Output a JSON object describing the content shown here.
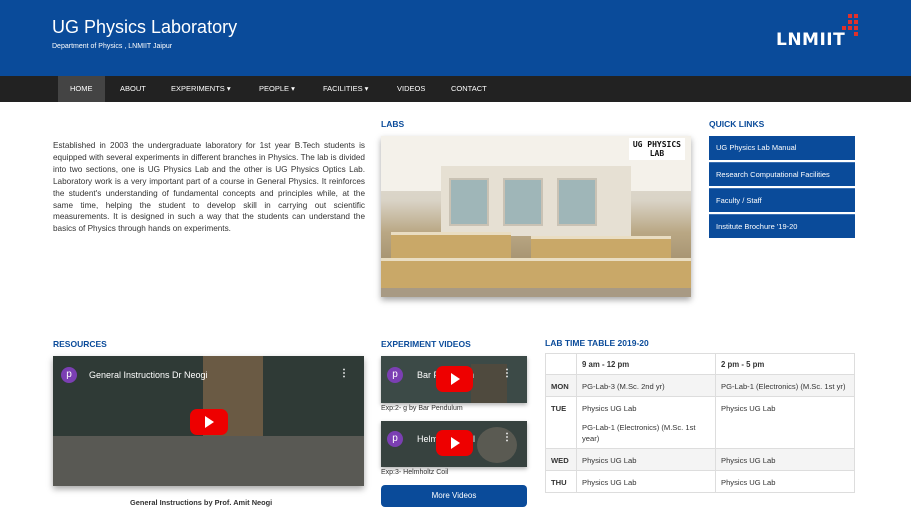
{
  "header": {
    "title": "UG Physics Laboratory",
    "subtitle": "Department of Physics , LNMIIT Jaipur",
    "logo_text": "LNMIIT"
  },
  "nav": {
    "items": [
      {
        "label": "HOME"
      },
      {
        "label": "ABOUT"
      },
      {
        "label": "EXPERIMENTS ▾"
      },
      {
        "label": "PEOPLE ▾"
      },
      {
        "label": "FACILITIES ▾"
      },
      {
        "label": "VIDEOS"
      },
      {
        "label": "CONTACT"
      }
    ]
  },
  "about": {
    "text": "Established in 2003 the undergraduate laboratory for 1st year B.Tech students is equipped with several experiments in different branches in Physics. The lab is divided into two sections, one is UG Physics Lab and the other is UG Physics Optics Lab. Laboratory work is a very important part of a course in General Physics. It reinforces the student's understanding of fundamental concepts and principles while, at the same time, helping the student to develop skill in carrying out scientific measurements. It is designed in such a way that the students can understand the basics of Physics through hands on experiments."
  },
  "labs": {
    "heading": "LABS",
    "image_label_1": "UG PHYSICS",
    "image_label_2": "LAB"
  },
  "quick_links": {
    "heading": "QUICK LINKS",
    "items": [
      {
        "label": "UG Physics Lab Manual"
      },
      {
        "label": "Research Computational Facilities"
      },
      {
        "label": "Faculty / Staff"
      },
      {
        "label": "Institute Brochure '19-20"
      }
    ]
  },
  "resources": {
    "heading": "RESOURCES",
    "video_title": "General Instructions Dr Neogi",
    "avatar_letter": "p",
    "caption": "General Instructions by Prof. Amit Neogi"
  },
  "experiment_videos": {
    "heading": "EXPERIMENT VIDEOS",
    "videos": [
      {
        "title": "Bar Pendulum",
        "avatar_letter": "p",
        "caption": "Exp:2- g by Bar Pendulum"
      },
      {
        "title": "Helmholtz Coil",
        "avatar_letter": "p",
        "caption": "Exp:3- Helmholtz Coil"
      }
    ],
    "more_label": "More Videos"
  },
  "timetable": {
    "heading": "LAB TIME TABLE 2019-20",
    "columns": [
      "",
      "9 am - 12 pm",
      "2 pm - 5 pm"
    ],
    "rows": [
      {
        "day": "MON",
        "am": [
          "PG-Lab-3 (M.Sc. 2nd yr)"
        ],
        "pm": [
          "PG-Lab-1 (Electronics) (M.Sc. 1st yr)"
        ]
      },
      {
        "day": "TUE",
        "am": [
          "Physics UG Lab",
          "PG-Lab-1 (Electronics) (M.Sc. 1st year)"
        ],
        "pm": [
          "Physics UG Lab"
        ]
      },
      {
        "day": "WED",
        "am": [
          "Physics UG Lab"
        ],
        "pm": [
          "Physics UG Lab"
        ]
      },
      {
        "day": "THU",
        "am": [
          "Physics UG Lab"
        ],
        "pm": [
          "Physics UG Lab"
        ]
      }
    ]
  },
  "colors": {
    "brand_blue": "#0a4b9a",
    "nav_bg": "#222222",
    "logo_accent": "#e0312b",
    "youtube_red": "#ee0000"
  }
}
